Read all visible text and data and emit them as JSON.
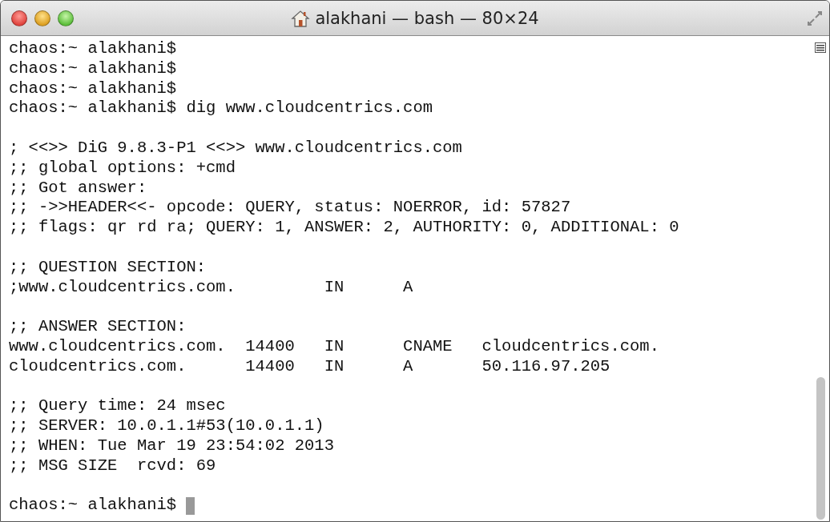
{
  "window": {
    "title": "alakhani — bash — 80×24"
  },
  "blocks": [
    [
      "chaos:~ alakhani$",
      "chaos:~ alakhani$",
      "chaos:~ alakhani$",
      "chaos:~ alakhani$ dig www.cloudcentrics.com"
    ],
    [
      "; <<>> DiG 9.8.3-P1 <<>> www.cloudcentrics.com",
      ";; global options: +cmd",
      ";; Got answer:",
      ";; ->>HEADER<<- opcode: QUERY, status: NOERROR, id: 57827",
      ";; flags: qr rd ra; QUERY: 1, ANSWER: 2, AUTHORITY: 0, ADDITIONAL: 0"
    ],
    [
      ";; QUESTION SECTION:",
      ";www.cloudcentrics.com.         IN      A"
    ],
    [
      ";; ANSWER SECTION:",
      "www.cloudcentrics.com.  14400   IN      CNAME   cloudcentrics.com.",
      "cloudcentrics.com.      14400   IN      A       50.116.97.205"
    ],
    [
      ";; Query time: 24 msec",
      ";; SERVER: 10.0.1.1#53(10.0.1.1)",
      ";; WHEN: Tue Mar 19 23:54:02 2013",
      ";; MSG SIZE  rcvd: 69"
    ]
  ],
  "prompt": {
    "text": "chaos:~ alakhani$",
    "cursor": true
  }
}
